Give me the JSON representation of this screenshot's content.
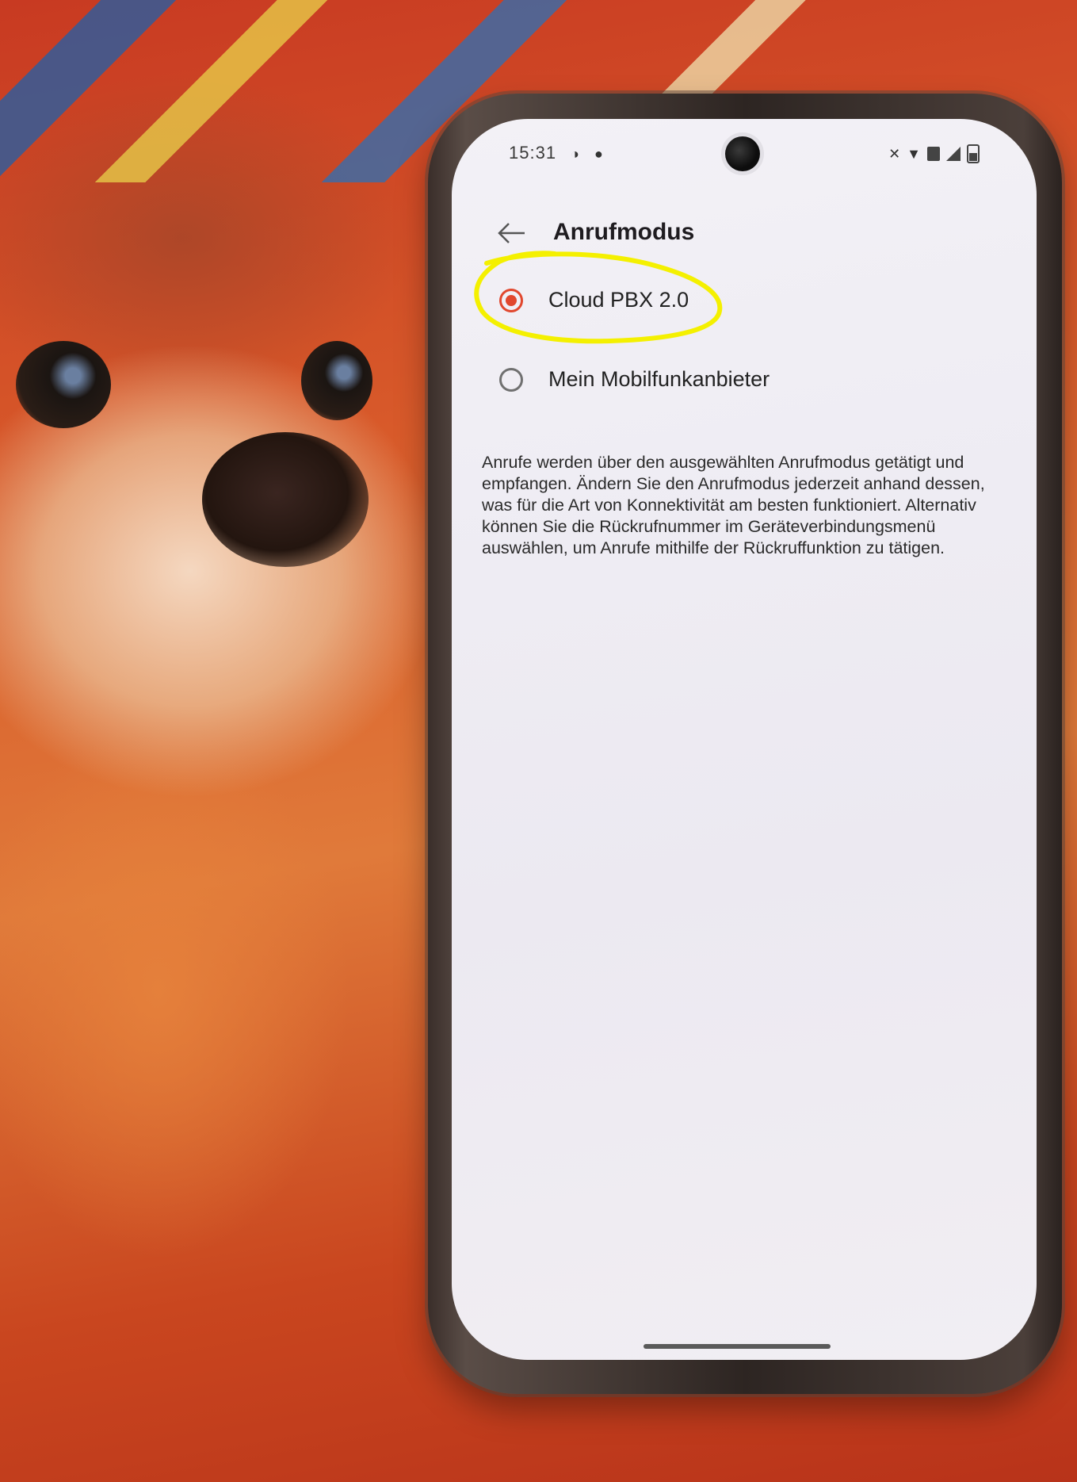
{
  "status_bar": {
    "time": "15:31",
    "icons": [
      "brightness-icon",
      "key-icon",
      "mute-icon",
      "wifi-icon",
      "volte-icon",
      "signal-icon",
      "battery-icon"
    ],
    "volte_label": "Vo"
  },
  "app_bar": {
    "back_icon": "arrow-left-icon",
    "title": "Anrufmodus"
  },
  "options": [
    {
      "label": "Cloud PBX 2.0",
      "selected": true
    },
    {
      "label": "Mein Mobilfunkanbieter",
      "selected": false
    }
  ],
  "description": "Anrufe werden über den ausgewählten Anrufmodus getätigt und empfangen. Ändern Sie den Anrufmodus jederzeit anhand dessen, was für die Art von Konnektivität am besten funktioniert. Alternativ können Sie die Rückrufnummer im Geräteverbindungsmenü auswählen, um Anrufe mithilfe der Rückruffunktion zu tätigen.",
  "colors": {
    "accent": "#e1472e",
    "highlight_marker": "#f4f000",
    "screen_background": "#efedf3"
  }
}
